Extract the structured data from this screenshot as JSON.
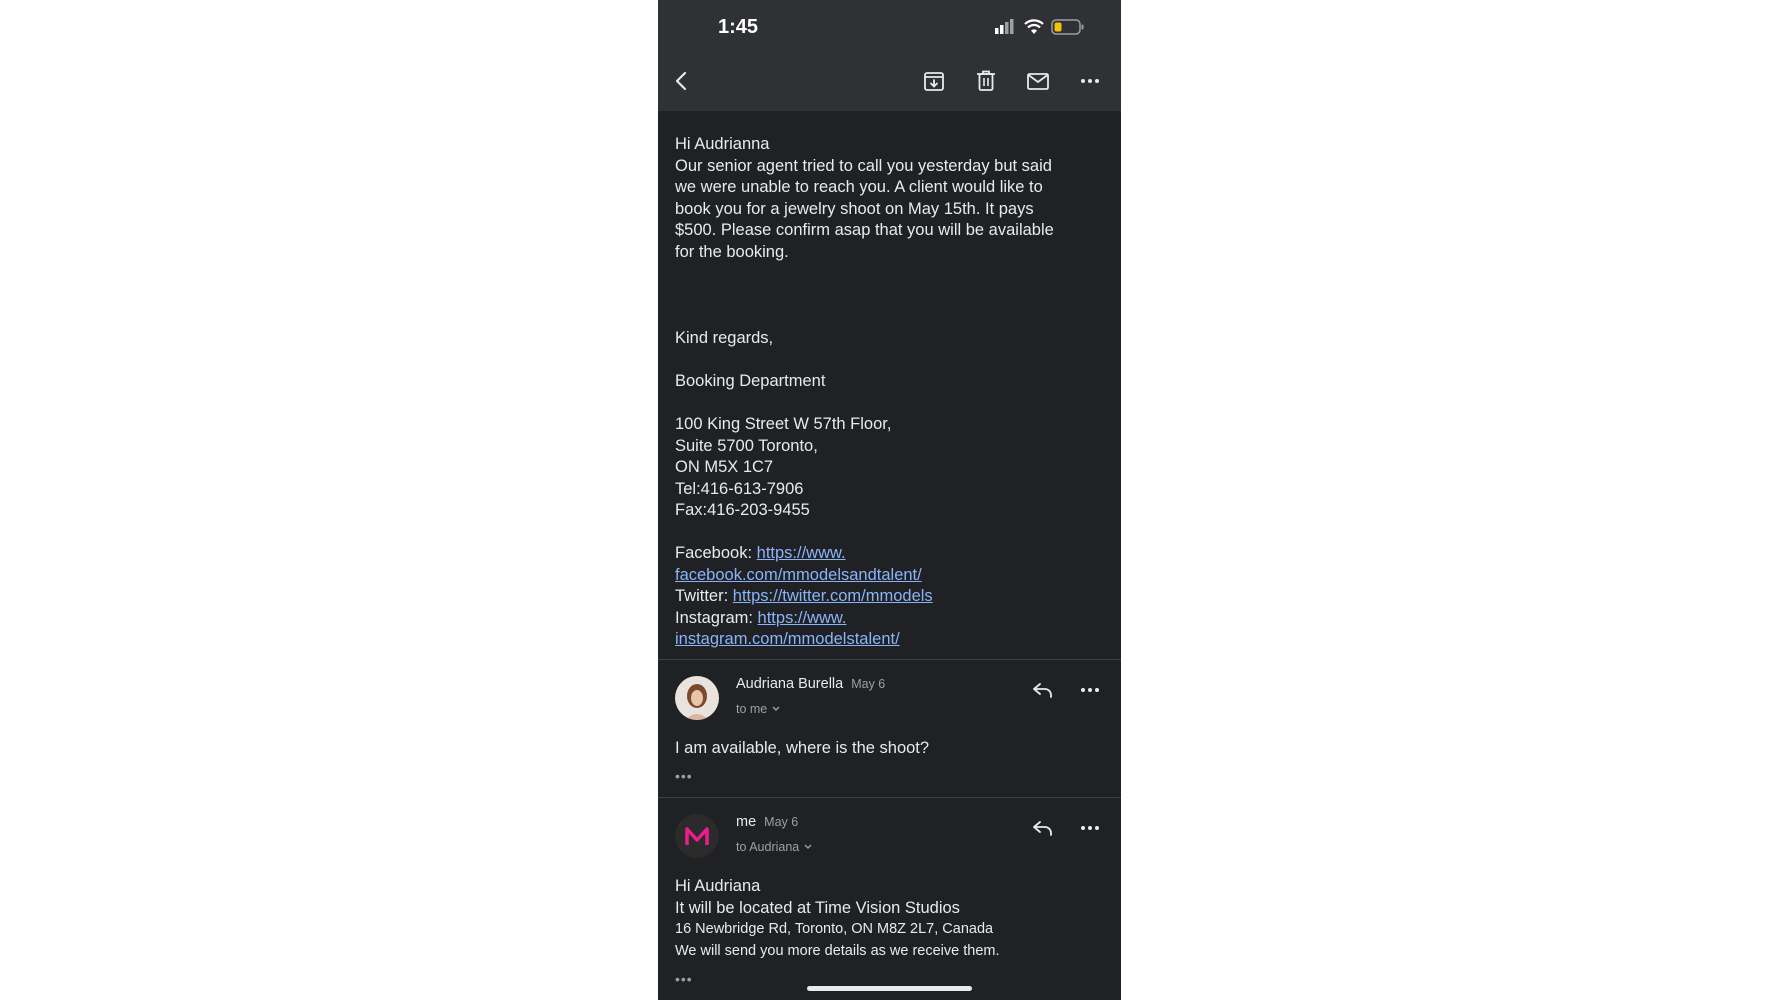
{
  "status_bar": {
    "time": "1:45"
  },
  "toolbar": {
    "back_icon": "chevron-left-icon",
    "archive_icon": "archive-icon",
    "delete_icon": "trash-icon",
    "mark_unread_icon": "mail-icon",
    "more_icon": "more-horizontal-icon"
  },
  "message1": {
    "greeting": "Hi Audrianna",
    "para": [
      "Our senior agent tried to call you yesterday but said",
      "we were unable to reach you. A client would like to",
      "book you for a jewelry shoot on May 15th. It pays",
      "$500. Please confirm asap that you will be available",
      "for the booking."
    ],
    "closing": "Kind regards,",
    "department": "Booking Department",
    "address": [
      "100 King Street W  57th Floor,",
      "Suite 5700 Toronto,",
      "ON M5X 1C7",
      "Tel:416-613-7906",
      "Fax:416-203-9455"
    ],
    "facebook_label": "Facebook: ",
    "facebook_link_1": "https://www.",
    "facebook_link_2": "facebook.com/mmodelsandtalent/",
    "twitter_label": "Twitter: ",
    "twitter_link": "https://twitter.com/mmodels",
    "instagram_label": "Instagram: ",
    "instagram_link_1": "https://www.",
    "instagram_link_2": "instagram.com/mmodelstalent/"
  },
  "message2": {
    "sender": "Audriana Burella",
    "date": "May 6",
    "recipient": "to me",
    "body": "I am available, where is the shoot?",
    "collapsed": "•••"
  },
  "message3": {
    "sender": "me",
    "date": "May 6",
    "recipient": "to Audriana",
    "greeting": "Hi Audriana",
    "line1": "It will be located at Time Vision Studios",
    "line2": "16 Newbridge Rd, Toronto, ON M8Z 2L7, Canada",
    "line3": "We will send you more details as we receive them.",
    "collapsed": "•••"
  },
  "colors": {
    "background": "#202124",
    "header": "#303134",
    "link": "#8ab4f8",
    "text": "#e8eaed",
    "muted": "#9aa0a6"
  }
}
